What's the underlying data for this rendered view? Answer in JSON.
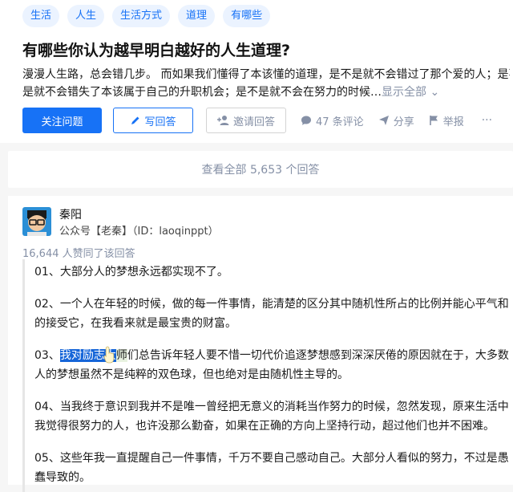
{
  "tags": [
    "生活",
    "人生",
    "生活方式",
    "道理",
    "有哪些"
  ],
  "question": {
    "title": "有哪些你认为越早明白越好的人生道理?",
    "desc_line1": "漫漫人生路，总会错几步。 而如果我们懂得了本该懂的道理，是不是就不会错过了那个爱的人；是不",
    "desc_line2": "是就不会错失了本该属于自己的升职机会；是不是就不会在努力的时候…",
    "show_all": "显示全部"
  },
  "actions": {
    "follow": "关注问题",
    "write": "写回答",
    "invite": "邀请回答",
    "comments": "47 条评论",
    "share": "分享",
    "report": "举报",
    "more": "···"
  },
  "view_all": "查看全部 5,653 个回答",
  "answer": {
    "author": "秦阳",
    "headline": "公众号【老秦】（ID：laoqinppt）",
    "votes": "16,644 人赞同了该回答",
    "p1": "01、大部分人的梦想永远都实现不了。",
    "p2": "02、一个人在年轻的时候，做的每一件事情，能清楚的区分其中随机性所占的比例并能心平气和的接受它，在我看来就是最宝贵的财富。",
    "p3_highlight": "我对励志大",
    "p3_prefix": "03、",
    "p3_mid": "师",
    "p3_rest": "们总告诉年轻人要不惜一切代价追逐梦想感到深深厌倦的原因就在于，大多数人的梦想虽然不是纯粹的双色球，但也绝对是由随机性主导的。",
    "p4": "04、当我终于意识到我并不是唯一曾经把无意义的消耗当作努力的时候，忽然发现，原来生活中我觉得很努力的人，也许没那么勤奋，如果在正确的方向上坚持行动，超过他们也并不困难。",
    "p5": "05、这些年我一直提醒自己一件事情，千万不要自己感动自己。大部分人看似的努力，不过是愚蠢导致的。"
  }
}
